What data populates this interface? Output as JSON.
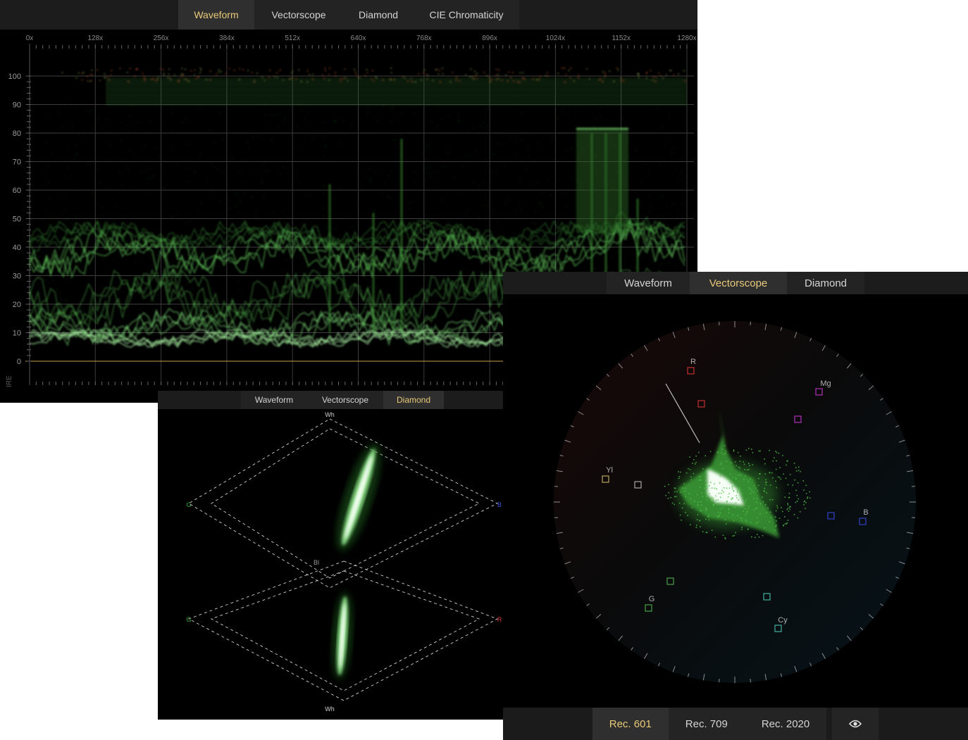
{
  "waveform_panel": {
    "tabs": [
      {
        "label": "Waveform",
        "active": true
      },
      {
        "label": "Vectorscope",
        "active": false
      },
      {
        "label": "Diamond",
        "active": false
      },
      {
        "label": "CIE Chromaticity",
        "active": false
      }
    ],
    "x_ticks": [
      "0x",
      "128x",
      "256x",
      "384x",
      "512x",
      "640x",
      "768x",
      "896x",
      "1024x",
      "1152x",
      "1280x"
    ],
    "y_ticks": [
      "100",
      "90",
      "80",
      "70",
      "60",
      "50",
      "40",
      "30",
      "20",
      "10",
      "0"
    ],
    "unit_label": "IRE"
  },
  "diamond_panel": {
    "tabs": [
      {
        "label": "Waveform",
        "active": false
      },
      {
        "label": "Vectorscope",
        "active": false
      },
      {
        "label": "Diamond",
        "active": true
      }
    ],
    "labels": {
      "top": "Wh",
      "bottom": "Wh",
      "upper_left": "G",
      "upper_right": "B",
      "lower_left": "G",
      "lower_right": "R",
      "center": "Bl"
    }
  },
  "vectorscope_panel": {
    "tabs": [
      {
        "label": "Waveform",
        "active": false
      },
      {
        "label": "Vectorscope",
        "active": true
      },
      {
        "label": "Diamond",
        "active": false
      }
    ],
    "targets": {
      "r": "R",
      "mg": "Mg",
      "yl": "Yl",
      "b": "B",
      "g": "G",
      "cy": "Cy"
    },
    "standards": [
      {
        "label": "Rec. 601",
        "active": true
      },
      {
        "label": "Rec. 709",
        "active": false
      },
      {
        "label": "Rec. 2020",
        "active": false
      }
    ],
    "eye_icon": "eye-icon"
  },
  "colors": {
    "accent": "#e9c97a",
    "trace": "#4caf3c",
    "zero_line": "#c8a04a"
  }
}
